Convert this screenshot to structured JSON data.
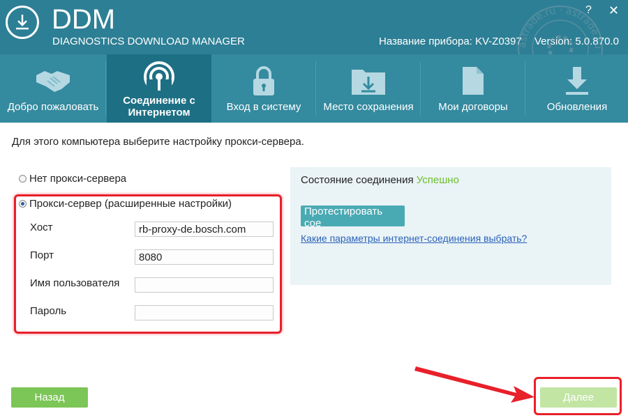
{
  "header": {
    "app_title": "DDM",
    "app_subtitle": "DIAGNOSTICS DOWNLOAD MANAGER",
    "device_name": "Название прибора: KV-Z0397",
    "version": "Version:  5.0.870.0",
    "help_label": "?",
    "close_label": "✕",
    "logo_icon": "download-icon"
  },
  "tabs": [
    {
      "label": "Добро пожаловать",
      "icon": "handshake-icon"
    },
    {
      "label_line1": "Соединение с",
      "label_line2": "Интернетом",
      "icon": "wireless-signal-icon",
      "active": true
    },
    {
      "label": "Вход в систему",
      "icon": "lock-icon"
    },
    {
      "label": "Место сохранения",
      "icon": "folder-download-icon"
    },
    {
      "label": "Мои договоры",
      "icon": "document-icon"
    },
    {
      "label": "Обновления",
      "icon": "download-update-icon"
    }
  ],
  "instruction": "Для этого компьютера выберите настройку прокси-сервера.",
  "proxy_options": [
    {
      "label": "Нет прокси-сервера",
      "selected": false
    },
    {
      "label": "Прокси-сервер (расширенные настройки)",
      "selected": true
    }
  ],
  "fields": {
    "host": {
      "label": "Хост",
      "value": "rb-proxy-de.bosch.com"
    },
    "port": {
      "label": "Порт",
      "value": "8080"
    },
    "username": {
      "label": "Имя пользователя",
      "value": ""
    },
    "password": {
      "label": "Пароль",
      "value": ""
    }
  },
  "status": {
    "label": "Состояние соединения",
    "value": "Успешно",
    "value_color": "#6bbf2e"
  },
  "test_button_label": "Протестировать сое",
  "help_link": "Какие параметры интернет-соединения выбрать?",
  "back_button_label": "Назад",
  "next_button_label": "Далее",
  "watermark_text": "astrade.ru",
  "colors": {
    "header": "#2d7f95",
    "tab_bar": "#348a9f",
    "tab_active": "#1d6f84",
    "highlight": "#e8202a",
    "button_green": "#7cc557",
    "button_disabled": "#c2e5a4",
    "test_button": "#4aaab3"
  }
}
